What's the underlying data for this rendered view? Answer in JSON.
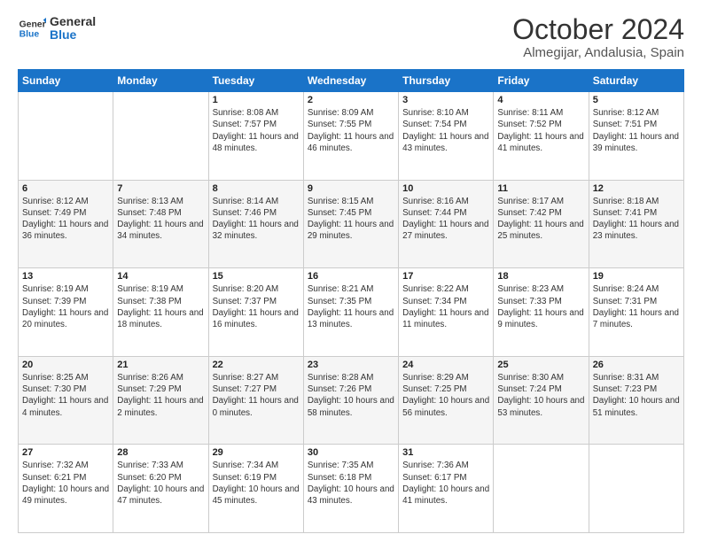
{
  "header": {
    "logo_general": "General",
    "logo_blue": "Blue",
    "title": "October 2024",
    "subtitle": "Almegijar, Andalusia, Spain"
  },
  "weekdays": [
    "Sunday",
    "Monday",
    "Tuesday",
    "Wednesday",
    "Thursday",
    "Friday",
    "Saturday"
  ],
  "weeks": [
    [
      null,
      null,
      {
        "day": 1,
        "sunrise": "Sunrise: 8:08 AM",
        "sunset": "Sunset: 7:57 PM",
        "daylight": "Daylight: 11 hours and 48 minutes."
      },
      {
        "day": 2,
        "sunrise": "Sunrise: 8:09 AM",
        "sunset": "Sunset: 7:55 PM",
        "daylight": "Daylight: 11 hours and 46 minutes."
      },
      {
        "day": 3,
        "sunrise": "Sunrise: 8:10 AM",
        "sunset": "Sunset: 7:54 PM",
        "daylight": "Daylight: 11 hours and 43 minutes."
      },
      {
        "day": 4,
        "sunrise": "Sunrise: 8:11 AM",
        "sunset": "Sunset: 7:52 PM",
        "daylight": "Daylight: 11 hours and 41 minutes."
      },
      {
        "day": 5,
        "sunrise": "Sunrise: 8:12 AM",
        "sunset": "Sunset: 7:51 PM",
        "daylight": "Daylight: 11 hours and 39 minutes."
      }
    ],
    [
      {
        "day": 6,
        "sunrise": "Sunrise: 8:12 AM",
        "sunset": "Sunset: 7:49 PM",
        "daylight": "Daylight: 11 hours and 36 minutes."
      },
      {
        "day": 7,
        "sunrise": "Sunrise: 8:13 AM",
        "sunset": "Sunset: 7:48 PM",
        "daylight": "Daylight: 11 hours and 34 minutes."
      },
      {
        "day": 8,
        "sunrise": "Sunrise: 8:14 AM",
        "sunset": "Sunset: 7:46 PM",
        "daylight": "Daylight: 11 hours and 32 minutes."
      },
      {
        "day": 9,
        "sunrise": "Sunrise: 8:15 AM",
        "sunset": "Sunset: 7:45 PM",
        "daylight": "Daylight: 11 hours and 29 minutes."
      },
      {
        "day": 10,
        "sunrise": "Sunrise: 8:16 AM",
        "sunset": "Sunset: 7:44 PM",
        "daylight": "Daylight: 11 hours and 27 minutes."
      },
      {
        "day": 11,
        "sunrise": "Sunrise: 8:17 AM",
        "sunset": "Sunset: 7:42 PM",
        "daylight": "Daylight: 11 hours and 25 minutes."
      },
      {
        "day": 12,
        "sunrise": "Sunrise: 8:18 AM",
        "sunset": "Sunset: 7:41 PM",
        "daylight": "Daylight: 11 hours and 23 minutes."
      }
    ],
    [
      {
        "day": 13,
        "sunrise": "Sunrise: 8:19 AM",
        "sunset": "Sunset: 7:39 PM",
        "daylight": "Daylight: 11 hours and 20 minutes."
      },
      {
        "day": 14,
        "sunrise": "Sunrise: 8:19 AM",
        "sunset": "Sunset: 7:38 PM",
        "daylight": "Daylight: 11 hours and 18 minutes."
      },
      {
        "day": 15,
        "sunrise": "Sunrise: 8:20 AM",
        "sunset": "Sunset: 7:37 PM",
        "daylight": "Daylight: 11 hours and 16 minutes."
      },
      {
        "day": 16,
        "sunrise": "Sunrise: 8:21 AM",
        "sunset": "Sunset: 7:35 PM",
        "daylight": "Daylight: 11 hours and 13 minutes."
      },
      {
        "day": 17,
        "sunrise": "Sunrise: 8:22 AM",
        "sunset": "Sunset: 7:34 PM",
        "daylight": "Daylight: 11 hours and 11 minutes."
      },
      {
        "day": 18,
        "sunrise": "Sunrise: 8:23 AM",
        "sunset": "Sunset: 7:33 PM",
        "daylight": "Daylight: 11 hours and 9 minutes."
      },
      {
        "day": 19,
        "sunrise": "Sunrise: 8:24 AM",
        "sunset": "Sunset: 7:31 PM",
        "daylight": "Daylight: 11 hours and 7 minutes."
      }
    ],
    [
      {
        "day": 20,
        "sunrise": "Sunrise: 8:25 AM",
        "sunset": "Sunset: 7:30 PM",
        "daylight": "Daylight: 11 hours and 4 minutes."
      },
      {
        "day": 21,
        "sunrise": "Sunrise: 8:26 AM",
        "sunset": "Sunset: 7:29 PM",
        "daylight": "Daylight: 11 hours and 2 minutes."
      },
      {
        "day": 22,
        "sunrise": "Sunrise: 8:27 AM",
        "sunset": "Sunset: 7:27 PM",
        "daylight": "Daylight: 11 hours and 0 minutes."
      },
      {
        "day": 23,
        "sunrise": "Sunrise: 8:28 AM",
        "sunset": "Sunset: 7:26 PM",
        "daylight": "Daylight: 10 hours and 58 minutes."
      },
      {
        "day": 24,
        "sunrise": "Sunrise: 8:29 AM",
        "sunset": "Sunset: 7:25 PM",
        "daylight": "Daylight: 10 hours and 56 minutes."
      },
      {
        "day": 25,
        "sunrise": "Sunrise: 8:30 AM",
        "sunset": "Sunset: 7:24 PM",
        "daylight": "Daylight: 10 hours and 53 minutes."
      },
      {
        "day": 26,
        "sunrise": "Sunrise: 8:31 AM",
        "sunset": "Sunset: 7:23 PM",
        "daylight": "Daylight: 10 hours and 51 minutes."
      }
    ],
    [
      {
        "day": 27,
        "sunrise": "Sunrise: 7:32 AM",
        "sunset": "Sunset: 6:21 PM",
        "daylight": "Daylight: 10 hours and 49 minutes."
      },
      {
        "day": 28,
        "sunrise": "Sunrise: 7:33 AM",
        "sunset": "Sunset: 6:20 PM",
        "daylight": "Daylight: 10 hours and 47 minutes."
      },
      {
        "day": 29,
        "sunrise": "Sunrise: 7:34 AM",
        "sunset": "Sunset: 6:19 PM",
        "daylight": "Daylight: 10 hours and 45 minutes."
      },
      {
        "day": 30,
        "sunrise": "Sunrise: 7:35 AM",
        "sunset": "Sunset: 6:18 PM",
        "daylight": "Daylight: 10 hours and 43 minutes."
      },
      {
        "day": 31,
        "sunrise": "Sunrise: 7:36 AM",
        "sunset": "Sunset: 6:17 PM",
        "daylight": "Daylight: 10 hours and 41 minutes."
      },
      null,
      null
    ]
  ]
}
